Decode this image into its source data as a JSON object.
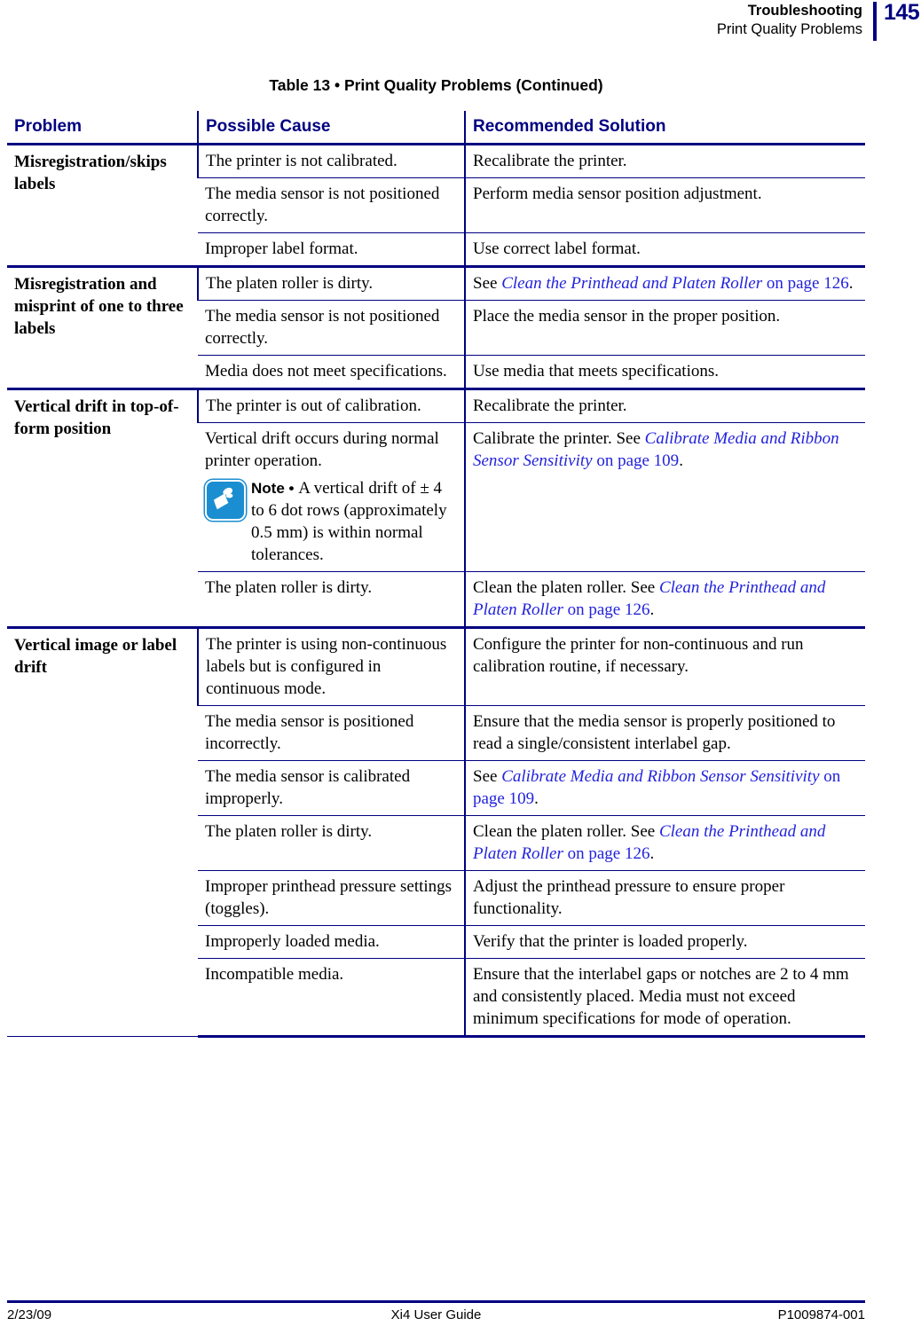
{
  "header": {
    "chapter": "Troubleshooting",
    "section": "Print Quality Problems",
    "page_number": "145",
    "rule_color": "#000080",
    "page_number_color": "#000080"
  },
  "table_title": "Table 13 • Print Quality Problems (Continued)",
  "table": {
    "columns": [
      "Problem",
      "Possible Cause",
      "Recommended Solution"
    ],
    "header_color": "#000080",
    "link_color": "#2222dd",
    "groups": [
      {
        "problem": "Misregistration/skips labels",
        "rows": [
          {
            "cause": "The printer is not calibrated.",
            "solution_parts": [
              {
                "text": "Recalibrate the printer.",
                "style": "plain"
              }
            ]
          },
          {
            "cause": "The media sensor is not positioned correctly.",
            "solution_parts": [
              {
                "text": "Perform media sensor position adjustment.",
                "style": "plain"
              }
            ]
          },
          {
            "cause": "Improper label format.",
            "solution_parts": [
              {
                "text": "Use correct label format.",
                "style": "plain"
              }
            ]
          }
        ]
      },
      {
        "problem": "Misregistration and misprint of one to three labels",
        "rows": [
          {
            "cause": "The platen roller is dirty.",
            "solution_parts": [
              {
                "text": "See ",
                "style": "plain"
              },
              {
                "text": "Clean the Printhead and Platen Roller",
                "style": "xref"
              },
              {
                "text": " on page 126",
                "style": "xref-plain"
              },
              {
                "text": ".",
                "style": "plain"
              }
            ]
          },
          {
            "cause": "The media sensor is not positioned correctly.",
            "solution_parts": [
              {
                "text": "Place the media sensor in the proper position.",
                "style": "plain"
              }
            ]
          },
          {
            "cause": "Media does not meet specifications.",
            "solution_parts": [
              {
                "text": "Use media that meets specifications.",
                "style": "plain"
              }
            ]
          }
        ]
      },
      {
        "problem": "Vertical drift in top-of-form position",
        "rows": [
          {
            "cause": "The printer is out of calibration.",
            "solution_parts": [
              {
                "text": "Recalibrate the printer.",
                "style": "plain"
              }
            ]
          },
          {
            "cause": "Vertical drift occurs during normal printer operation.",
            "note": {
              "icon": "zebra-note-icon",
              "icon_color": "#1b8ed1",
              "label": "Note • ",
              "text": "A vertical drift of ± 4 to 6 dot rows (approximately 0.5 mm) is within normal tolerances."
            },
            "solution_parts": [
              {
                "text": "Calibrate the printer. See ",
                "style": "plain"
              },
              {
                "text": "Calibrate Media and Ribbon Sensor Sensitivity",
                "style": "xref"
              },
              {
                "text": " on page 109",
                "style": "xref-plain"
              },
              {
                "text": ".",
                "style": "plain"
              }
            ]
          },
          {
            "cause": "The platen roller is dirty.",
            "solution_parts": [
              {
                "text": "Clean the platen roller. See ",
                "style": "plain"
              },
              {
                "text": "Clean the Printhead and Platen Roller",
                "style": "xref"
              },
              {
                "text": " on page 126",
                "style": "xref-plain"
              },
              {
                "text": ".",
                "style": "plain"
              }
            ]
          }
        ]
      },
      {
        "problem": "Vertical image or label drift",
        "rows": [
          {
            "cause": "The printer is using non-continuous labels but is configured in continuous mode.",
            "solution_parts": [
              {
                "text": "Configure the printer for non-continuous and run calibration routine, if necessary.",
                "style": "plain"
              }
            ]
          },
          {
            "cause": "The media sensor is positioned incorrectly.",
            "solution_parts": [
              {
                "text": "Ensure that the media sensor is properly positioned to read a single/consistent interlabel gap.",
                "style": "plain"
              }
            ]
          },
          {
            "cause": "The media sensor is calibrated improperly.",
            "solution_parts": [
              {
                "text": "See ",
                "style": "plain"
              },
              {
                "text": "Calibrate Media and Ribbon Sensor Sensitivity",
                "style": "xref"
              },
              {
                "text": " on page 109",
                "style": "xref-plain"
              },
              {
                "text": ".",
                "style": "plain"
              }
            ]
          },
          {
            "cause": "The platen roller is dirty.",
            "solution_parts": [
              {
                "text": "Clean the platen roller. See ",
                "style": "plain"
              },
              {
                "text": "Clean the Printhead and Platen Roller",
                "style": "xref"
              },
              {
                "text": " on page 126",
                "style": "xref-plain"
              },
              {
                "text": ".",
                "style": "plain"
              }
            ]
          },
          {
            "cause": "Improper printhead pressure settings (toggles).",
            "solution_parts": [
              {
                "text": "Adjust the printhead pressure to ensure proper functionality.",
                "style": "plain"
              }
            ]
          },
          {
            "cause": "Improperly loaded media.",
            "solution_parts": [
              {
                "text": "Verify that the printer is loaded properly.",
                "style": "plain"
              }
            ]
          },
          {
            "cause": "Incompatible media.",
            "solution_parts": [
              {
                "text": "Ensure that the interlabel gaps or notches are 2 to 4 mm and consistently placed. Media must not exceed minimum specifications for mode of operation.",
                "style": "plain"
              }
            ]
          }
        ]
      }
    ]
  },
  "footer": {
    "date": "2/23/09",
    "guide": "Xi4 User Guide",
    "part_number": "P1009874-001"
  }
}
